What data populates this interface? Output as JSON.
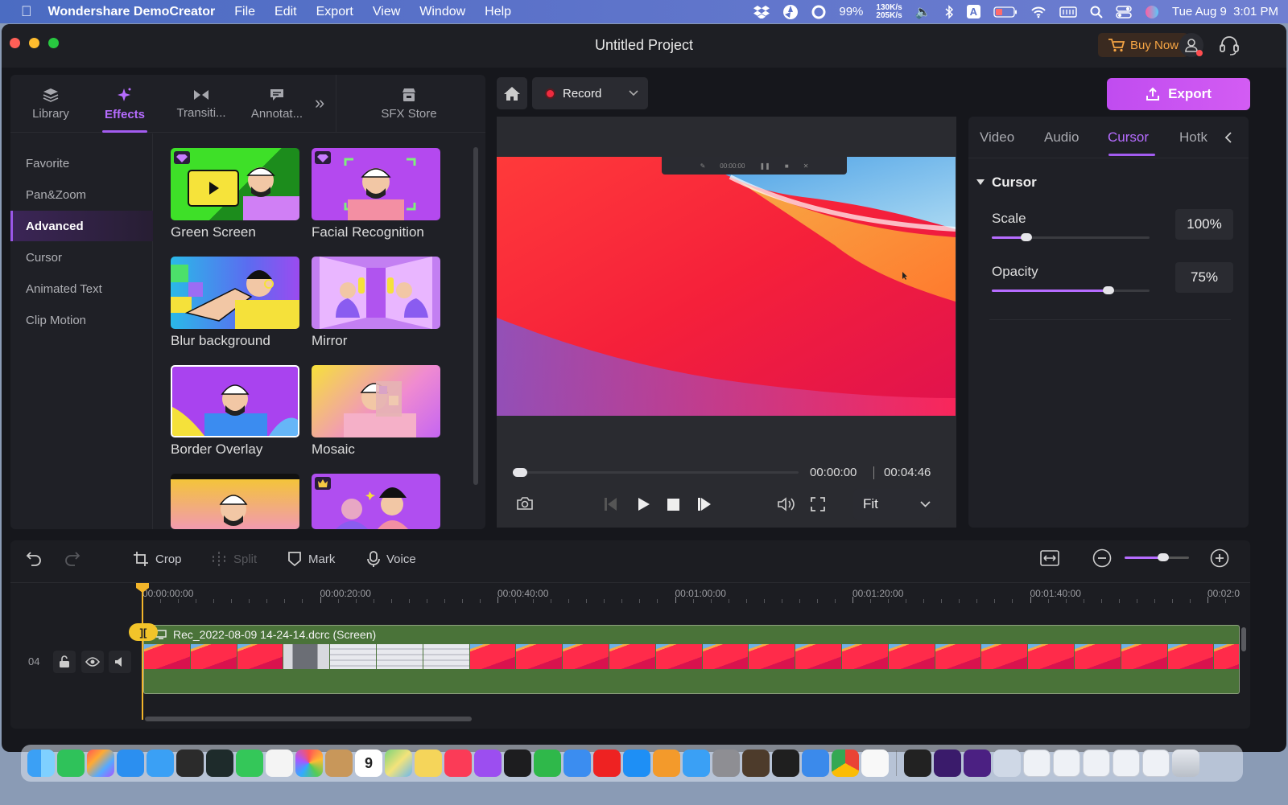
{
  "menubar": {
    "app_name": "Wondershare DemoCreator",
    "menus": [
      "File",
      "Edit",
      "Export",
      "View",
      "Window",
      "Help"
    ],
    "battery_percent": "99%",
    "net_up": "130K/s",
    "net_down": "205K/s",
    "input_source": "A",
    "datetime": "Tue Aug 9  3:01 PM"
  },
  "window": {
    "title": "Untitled Project",
    "buy_now": "Buy Now"
  },
  "left_panel": {
    "tabs": [
      {
        "label": "Library",
        "icon": "layers-icon"
      },
      {
        "label": "Effects",
        "icon": "sparkle-icon",
        "active": true
      },
      {
        "label": "Transiti...",
        "icon": "bowtie-icon"
      },
      {
        "label": "Annotat...",
        "icon": "comment-icon"
      }
    ],
    "more": "»",
    "sfx_store": "SFX Store",
    "sidebar": [
      "Favorite",
      "Pan&Zoom",
      "Advanced",
      "Cursor",
      "Animated Text",
      "Clip Motion"
    ],
    "active_sidebar": "Advanced",
    "effects": [
      {
        "label": "Green Screen",
        "premium": true
      },
      {
        "label": "Facial Recognition",
        "premium": true
      },
      {
        "label": "Blur background",
        "premium": false
      },
      {
        "label": "Mirror",
        "premium": false
      },
      {
        "label": "Border Overlay",
        "premium": false,
        "selected": true
      },
      {
        "label": "Mosaic",
        "premium": false
      },
      {
        "label": "",
        "premium": false
      },
      {
        "label": "",
        "premium": true
      }
    ]
  },
  "preview": {
    "record_label": "Record",
    "current_time": "00:00:00",
    "total_time": "00:04:46",
    "fit_label": "Fit",
    "mini_toolbar_time": "00:00:00",
    "progress": 0.0
  },
  "export": {
    "label": "Export"
  },
  "right_panel": {
    "tabs": [
      "Video",
      "Audio",
      "Cursor",
      "Hotk"
    ],
    "active_tab": "Cursor",
    "section": "Cursor",
    "scale_label": "Scale",
    "scale_value": "100%",
    "scale_fraction": 0.22,
    "opacity_label": "Opacity",
    "opacity_value": "75%",
    "opacity_fraction": 0.74
  },
  "timeline": {
    "tools": {
      "crop": "Crop",
      "split": "Split",
      "mark": "Mark",
      "voice": "Voice"
    },
    "ruler_labels": [
      "00:00:00:00",
      "00:00:20:00",
      "00:00:40:00",
      "00:01:00:00",
      "00:01:20:00",
      "00:01:40:00",
      "00:02:0"
    ],
    "track_number": "04",
    "clip_name": "Rec_2022-08-09 14-24-14.dcrc (Screen)",
    "zoom_fraction": 0.6
  },
  "dock": {
    "apps": [
      "finder-icon",
      "facetime-icon",
      "launchpad-icon",
      "safari-icon",
      "mail-icon",
      "console-icon",
      "activity-icon",
      "messages-icon",
      "reminders-icon",
      "photos-icon",
      "contacts-icon",
      "calendar-icon",
      "maps-icon",
      "notes-icon",
      "music-icon",
      "podcasts-icon",
      "tv-icon",
      "numbers-icon",
      "keynote-icon",
      "netease-icon",
      "appstore-icon",
      "pages-icon",
      "xcode-icon",
      "settings-icon",
      "instruments-icon",
      "terminal-icon",
      "preview-icon",
      "chrome-icon",
      "textedit-icon"
    ],
    "tail": [
      "piano-icon",
      "democreator-icon",
      "democreator2-icon",
      "screenshot-icon"
    ],
    "calendar_day": "9"
  }
}
